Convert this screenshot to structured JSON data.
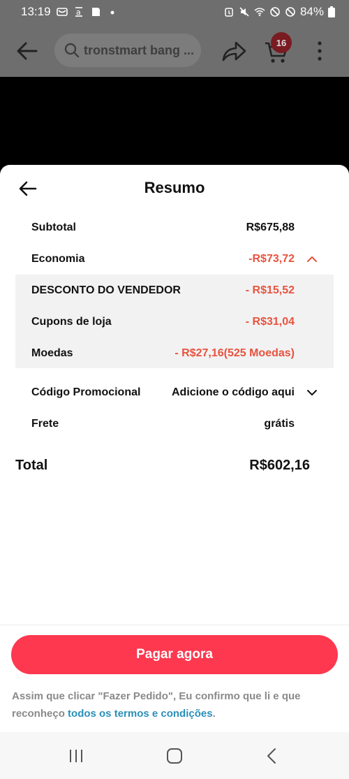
{
  "status_bar": {
    "time": "13:19",
    "battery": "84%"
  },
  "app_header": {
    "search_text": "tronstmart bang ...",
    "cart_count": "16"
  },
  "summary": {
    "title": "Resumo",
    "subtotal_label": "Subtotal",
    "subtotal_value": "R$675,88",
    "savings_label": "Economia",
    "savings_value": "-R$73,72",
    "discounts": [
      {
        "label": "DESCONTO DO VENDEDOR",
        "value": "- R$15,52"
      },
      {
        "label": "Cupons de loja",
        "value": "- R$31,04"
      },
      {
        "label": "Moedas",
        "value": "- R$27,16(525 Moedas)"
      }
    ],
    "promo_label": "Código Promocional",
    "promo_value": "Adicione o código aqui",
    "shipping_label": "Frete",
    "shipping_value": "grátis",
    "total_label": "Total",
    "total_value": "R$602,16"
  },
  "pay_button": "Pagar agora",
  "terms": {
    "text": "Assim que clicar \"Fazer Pedido\", Eu confirmo que li e que reconheço ",
    "link": "todos os termos e condições",
    "end": "."
  },
  "colors": {
    "accent": "#fd384f",
    "discount_red": "#e8533f",
    "link": "#2a8fb9"
  }
}
